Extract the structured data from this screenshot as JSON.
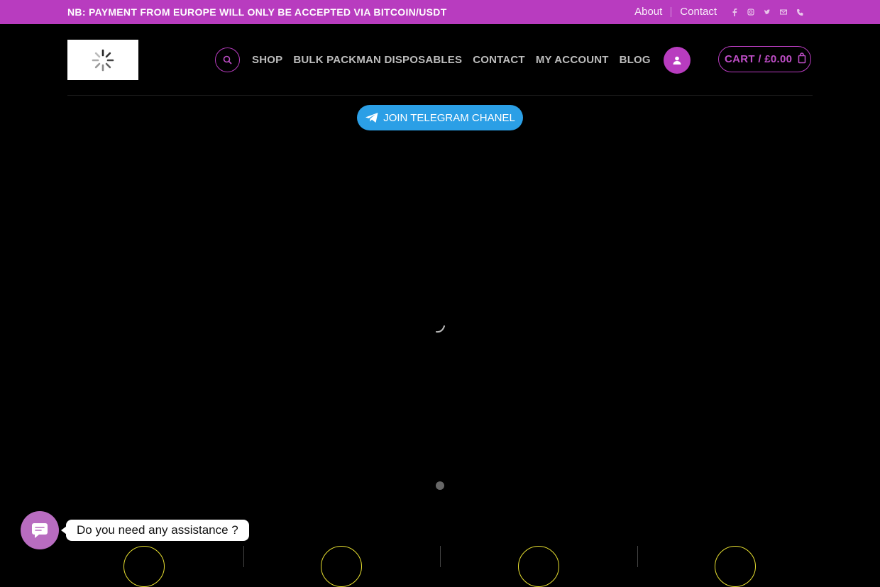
{
  "topbar": {
    "notice": "NB: PAYMENT FROM EUROPE WILL ONLY BE ACCEPTED VIA BITCOIN/USDT",
    "links": [
      "About",
      "Contact"
    ],
    "social_icons": [
      "facebook-icon",
      "instagram-icon",
      "twitter-icon",
      "email-icon",
      "phone-icon"
    ],
    "bg_color": "#b83cbf"
  },
  "header": {
    "nav": [
      "SHOP",
      "BULK PACKMAN DISPOSABLES",
      "CONTACT",
      "MY ACCOUNT",
      "BLOG"
    ],
    "cart_label": "CART / £0.00",
    "search_icon": "search-icon",
    "account_icon": "user-icon",
    "cart_icon": "bag-icon"
  },
  "telegram": {
    "label": "JOIN TELEGRAM CHANEL",
    "color": "#2b9fe6"
  },
  "chat": {
    "prompt": "Do you need any assistance ?"
  }
}
